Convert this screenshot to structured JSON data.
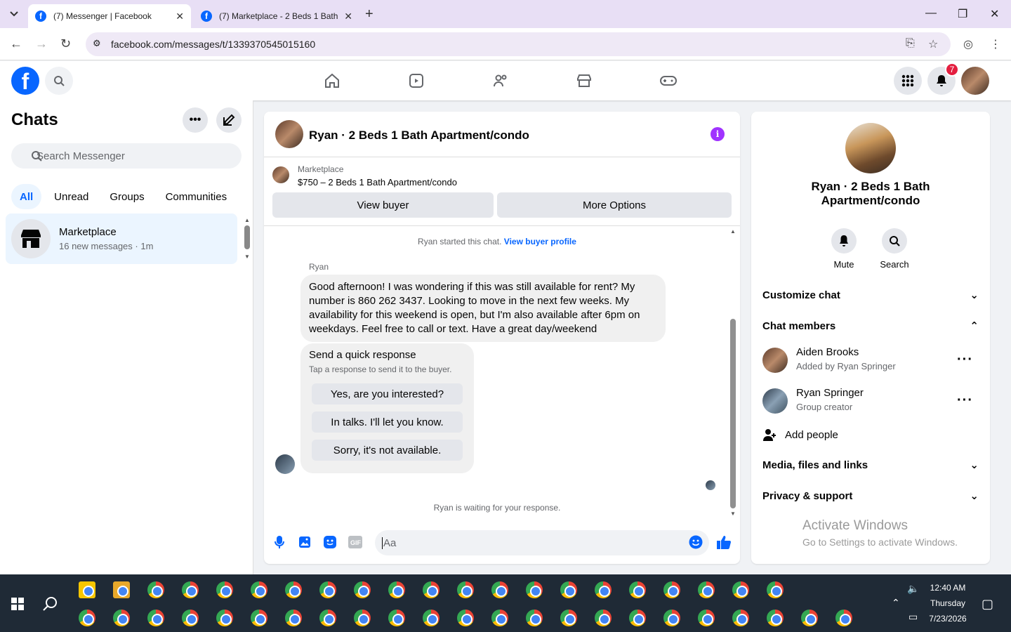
{
  "browser": {
    "tabs": [
      {
        "title": "(7) Messenger | Facebook"
      },
      {
        "title": "(7) Marketplace - 2 Beds 1 Bath"
      }
    ],
    "url": "facebook.com/messages/t/1339370545015160"
  },
  "facebook": {
    "notification_count": "7"
  },
  "chats": {
    "title": "Chats",
    "search_placeholder": "Search Messenger",
    "filters": [
      "All",
      "Unread",
      "Groups",
      "Communities"
    ],
    "items": [
      {
        "name": "Marketplace",
        "preview": "16 new messages · 1m"
      }
    ]
  },
  "conversation": {
    "title": "Ryan · 2 Beds 1 Bath Apartment/condo",
    "marketplace_label": "Marketplace",
    "listing": "$750 – 2 Beds 1 Bath Apartment/condo",
    "view_buyer": "View buyer",
    "more_options": "More Options",
    "started_text": "Ryan started this chat.",
    "started_link": "View buyer profile",
    "sender": "Ryan",
    "message": "Good afternoon! I was wondering if this was still available for rent? My number is 860 262 3437. Looking to move in the next few weeks. My availability for this weekend is open, but I'm also available after 6pm on weekdays. Feel free to call or text. Have a great day/weekend",
    "quick_title": "Send a quick response",
    "quick_subtitle": "Tap a response to send it to the buyer.",
    "quick_responses": [
      "Yes, are you interested?",
      "In talks. I'll let you know.",
      "Sorry, it's not available."
    ],
    "waiting": "Ryan is waiting for your response.",
    "composer_placeholder": "Aa"
  },
  "details": {
    "name": "Ryan · 2 Beds 1 Bath Apartment/condo",
    "actions": [
      "Mute",
      "Search"
    ],
    "customize": "Customize chat",
    "members_title": "Chat members",
    "members": [
      {
        "name": "Aiden Brooks",
        "sub": "Added by Ryan Springer"
      },
      {
        "name": "Ryan Springer",
        "sub": "Group creator"
      }
    ],
    "add_people": "Add people",
    "media": "Media, files and links",
    "privacy": "Privacy & support"
  },
  "watermark": {
    "line1": "Activate Windows",
    "line2": "Go to Settings to activate Windows."
  },
  "taskbar": {
    "time": "12:40 AM",
    "day": "Thursday",
    "date": "7/23/2026"
  },
  "colors": {
    "brand": "#0866ff",
    "info": "#a033ff",
    "badge": "#e41e3f"
  }
}
